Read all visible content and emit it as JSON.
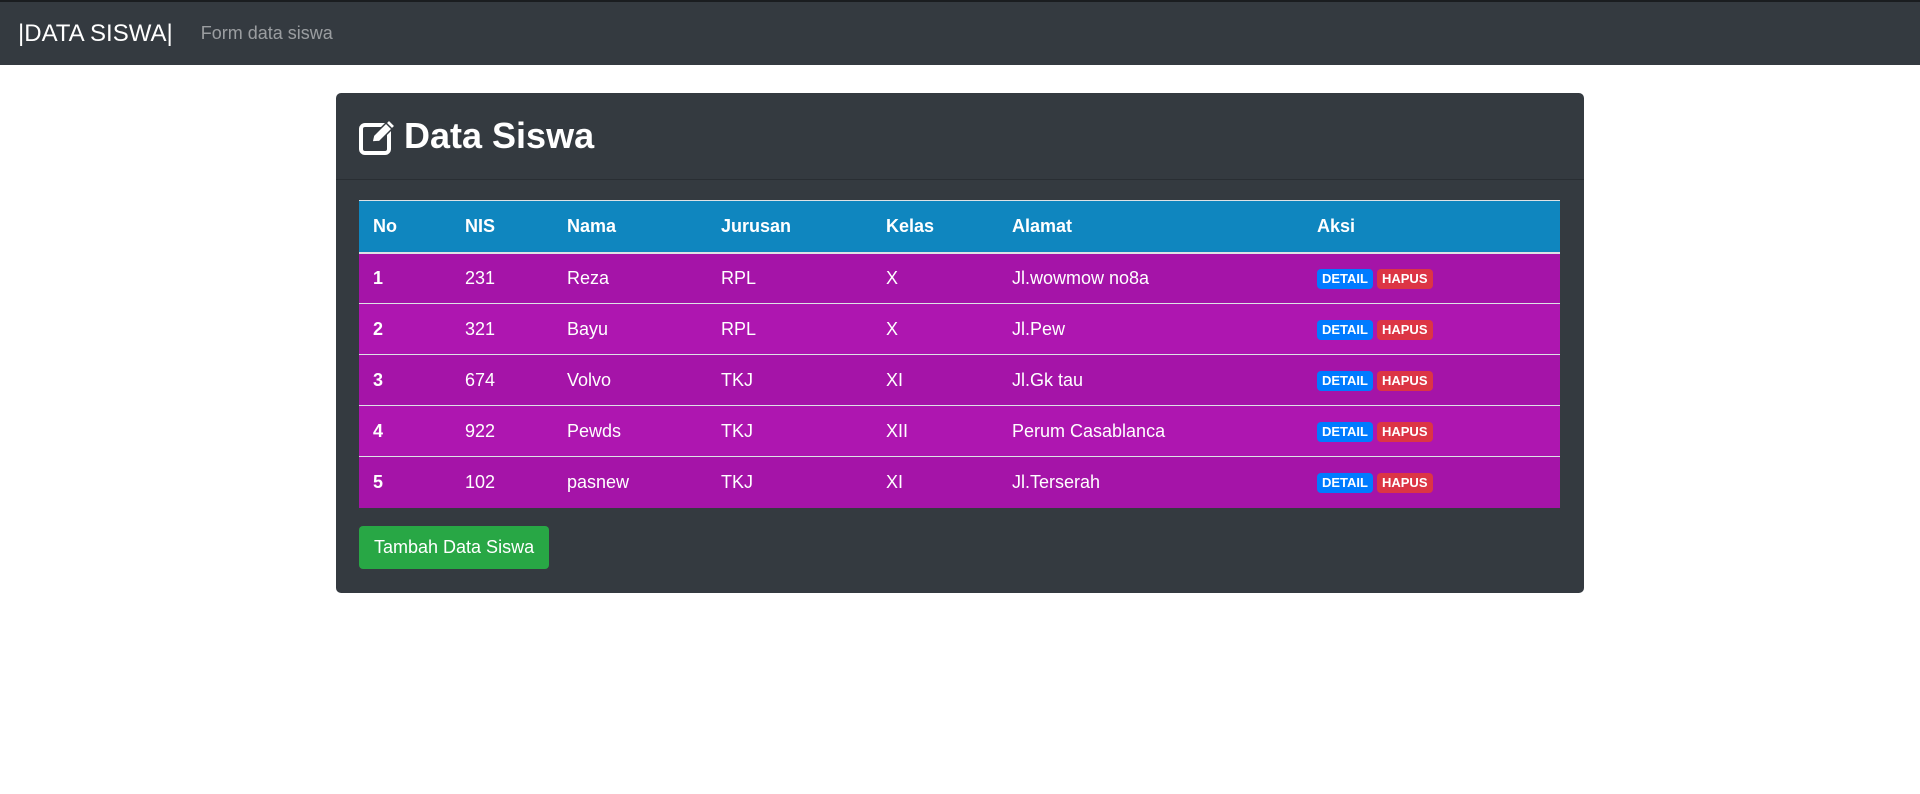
{
  "navbar": {
    "brand": "|DATA SISWA|",
    "link": "Form data siswa"
  },
  "card": {
    "title": "Data Siswa",
    "title_icon": "edit-icon"
  },
  "table": {
    "headers": [
      "No",
      "NIS",
      "Nama",
      "Jurusan",
      "Kelas",
      "Alamat",
      "Aksi"
    ],
    "rows": [
      {
        "no": "1",
        "nis": "231",
        "nama": "Reza",
        "jurusan": "RPL",
        "kelas": "X",
        "alamat": "Jl.wowmow no8a"
      },
      {
        "no": "2",
        "nis": "321",
        "nama": "Bayu",
        "jurusan": "RPL",
        "kelas": "X",
        "alamat": "Jl.Pew"
      },
      {
        "no": "3",
        "nis": "674",
        "nama": "Volvo",
        "jurusan": "TKJ",
        "kelas": "XI",
        "alamat": "Jl.Gk tau"
      },
      {
        "no": "4",
        "nis": "922",
        "nama": "Pewds",
        "jurusan": "TKJ",
        "kelas": "XII",
        "alamat": "Perum Casablanca"
      },
      {
        "no": "5",
        "nis": "102",
        "nama": "pasnew",
        "jurusan": "TKJ",
        "kelas": "XI",
        "alamat": "Jl.Terserah"
      }
    ],
    "detail_label": "DETAIL",
    "delete_label": "HAPUS"
  },
  "add_button_label": "Tambah Data Siswa",
  "colors": {
    "navbar_bg": "#343a40",
    "table_header_bg": "#0f86bf",
    "row_bg": "#a514a8",
    "detail_badge": "#007bff",
    "delete_badge": "#dc3545",
    "add_button": "#28a745"
  }
}
